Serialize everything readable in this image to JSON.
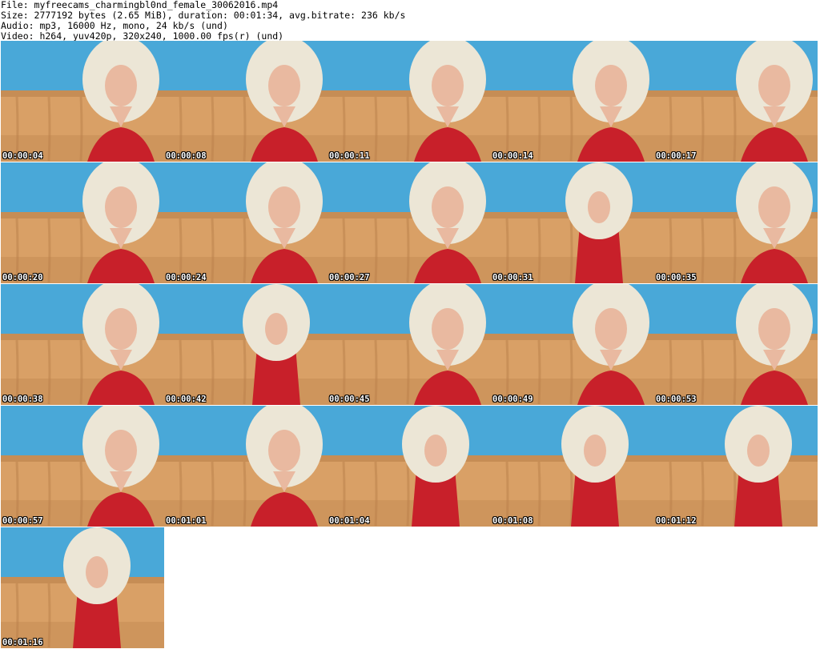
{
  "header": {
    "file_line": "File: myfreecams_charmingbl0nd_female_30062016.mp4",
    "size_line": "Size: 2777192 bytes (2.65 MiB), duration: 00:01:34, avg.bitrate: 236 kb/s",
    "audio_line": "Audio: mp3, 16000 Hz, mono, 24 kb/s (und)",
    "video_line": "Video: h264, yuv420p, 320x240, 1000.00 fps(r) (und)"
  },
  "thumbnails": [
    {
      "timestamp": "00:00:04"
    },
    {
      "timestamp": "00:00:08"
    },
    {
      "timestamp": "00:00:11"
    },
    {
      "timestamp": "00:00:14"
    },
    {
      "timestamp": "00:00:17"
    },
    {
      "timestamp": "00:00:20"
    },
    {
      "timestamp": "00:00:24"
    },
    {
      "timestamp": "00:00:27"
    },
    {
      "timestamp": "00:00:31"
    },
    {
      "timestamp": "00:00:35"
    },
    {
      "timestamp": "00:00:38"
    },
    {
      "timestamp": "00:00:42"
    },
    {
      "timestamp": "00:00:45"
    },
    {
      "timestamp": "00:00:49"
    },
    {
      "timestamp": "00:00:53"
    },
    {
      "timestamp": "00:00:57"
    },
    {
      "timestamp": "00:01:01"
    },
    {
      "timestamp": "00:01:04"
    },
    {
      "timestamp": "00:01:08"
    },
    {
      "timestamp": "00:01:12"
    },
    {
      "timestamp": "00:01:16"
    }
  ],
  "colors": {
    "wall": "#49a8d8",
    "sofa": "#d9a066",
    "sofa_dark": "#b9804a",
    "hair": "#ece6d6",
    "skin": "#e9b9a0",
    "top": "#c8202a"
  }
}
